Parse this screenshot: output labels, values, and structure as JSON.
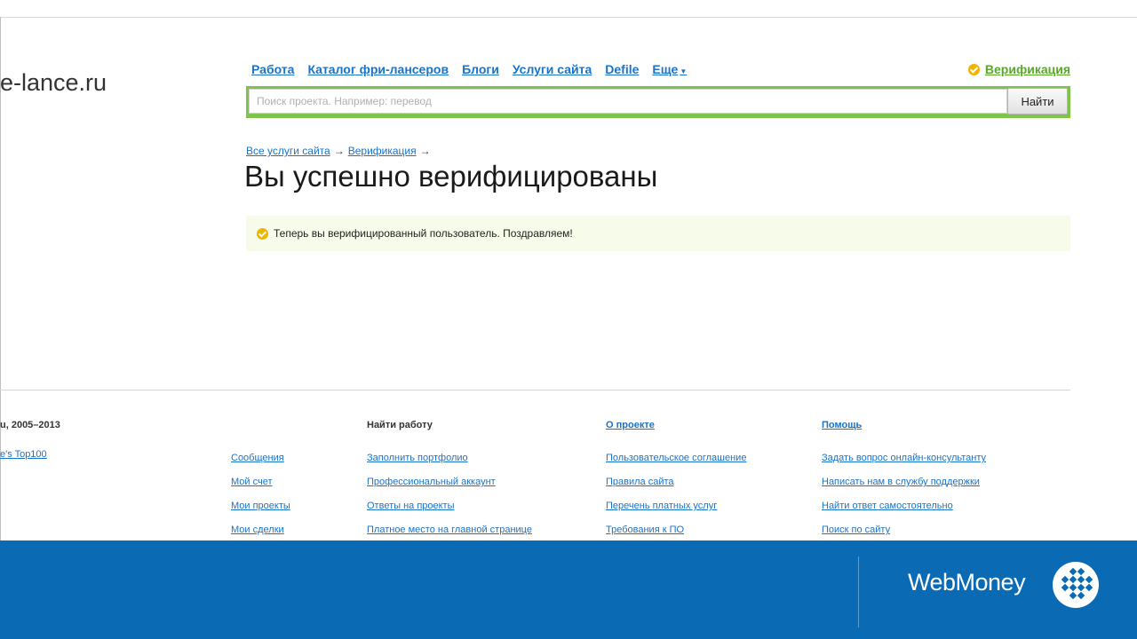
{
  "logo": {
    "text": "e-lance.ru"
  },
  "topnav": {
    "items": [
      "Работа",
      "Каталог фри-лансеров",
      "Блоги",
      "Услуги сайта",
      "Defile"
    ],
    "more": "Еще"
  },
  "verification_link": "Верификация",
  "search": {
    "placeholder": "Поиск проекта. Например: перевод",
    "button": "Найти"
  },
  "breadcrumb": {
    "items": [
      "Все услуги сайта",
      "Верификация"
    ],
    "separator": "→"
  },
  "page_title": "Вы успешно верифицированы",
  "notice": "Теперь вы верифицированный пользователь. Поздравляем!",
  "footer": {
    "copyright": "u, 2005–2013",
    "top100": "e's Top100",
    "col1": [
      "Сообщения",
      "Мой счет",
      "Мои проекты",
      "Мои сделки"
    ],
    "col2_title": "Найти работу",
    "col2": [
      "Заполнить портфолио",
      "Профессиональный аккаунт",
      "Ответы на проекты",
      "Платное место на главной странице"
    ],
    "col3_title": "О проекте",
    "col3": [
      "Пользовательское соглашение",
      "Правила сайта",
      "Перечень платных услуг",
      "Требования к ПО"
    ],
    "col4_title": "Помощь",
    "col4": [
      "Задать вопрос онлайн-консультанту",
      "Написать нам в службу поддержки",
      "Найти ответ самостоятельно",
      "Поиск по сайту"
    ]
  },
  "banner": {
    "brand": "WebMoney",
    "color": "#0a6ab4"
  },
  "colors": {
    "link": "#1a73c8",
    "accent_green": "#7fc44a",
    "verify_green": "#5aa82a",
    "check_yellow": "#f0b400"
  }
}
